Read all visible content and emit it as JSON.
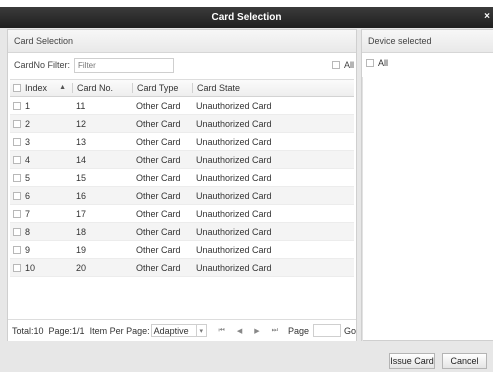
{
  "window": {
    "title": "Card Selection",
    "close_glyph": "×"
  },
  "left_panel": {
    "header": "Card Selection",
    "filter_label": "CardNo Filter:",
    "filter_placeholder": "Filter",
    "all_label": "All"
  },
  "table": {
    "columns": {
      "index": "Index",
      "card_no": "Card No.",
      "card_type": "Card Type",
      "card_state": "Card State"
    },
    "rows": [
      {
        "index": "1",
        "card_no": "11",
        "card_type": "Other Card",
        "card_state": "Unauthorized Card"
      },
      {
        "index": "2",
        "card_no": "12",
        "card_type": "Other Card",
        "card_state": "Unauthorized Card"
      },
      {
        "index": "3",
        "card_no": "13",
        "card_type": "Other Card",
        "card_state": "Unauthorized Card"
      },
      {
        "index": "4",
        "card_no": "14",
        "card_type": "Other Card",
        "card_state": "Unauthorized Card"
      },
      {
        "index": "5",
        "card_no": "15",
        "card_type": "Other Card",
        "card_state": "Unauthorized Card"
      },
      {
        "index": "6",
        "card_no": "16",
        "card_type": "Other Card",
        "card_state": "Unauthorized Card"
      },
      {
        "index": "7",
        "card_no": "17",
        "card_type": "Other Card",
        "card_state": "Unauthorized Card"
      },
      {
        "index": "8",
        "card_no": "18",
        "card_type": "Other Card",
        "card_state": "Unauthorized Card"
      },
      {
        "index": "9",
        "card_no": "19",
        "card_type": "Other Card",
        "card_state": "Unauthorized Card"
      },
      {
        "index": "10",
        "card_no": "20",
        "card_type": "Other Card",
        "card_state": "Unauthorized Card"
      }
    ]
  },
  "footer": {
    "total": "Total:10",
    "page": "Page:1/1",
    "items_per_page_label": "Item Per Page:",
    "items_per_page_value": "Adaptive",
    "page_label": "Page",
    "go_label": "Go",
    "pager_glyphs": [
      "⏮",
      "◀",
      "▶",
      "⏭"
    ]
  },
  "right_panel": {
    "header": "Device selected",
    "all_label": "All"
  },
  "buttons": {
    "issue_card": "Issue Card",
    "cancel": "Cancel"
  }
}
